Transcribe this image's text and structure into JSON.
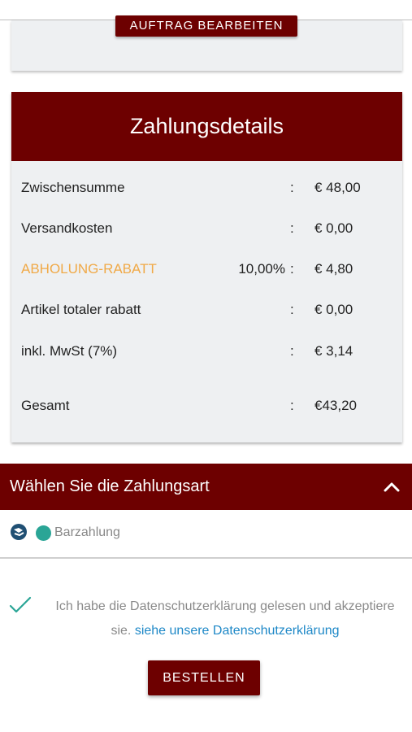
{
  "edit_order": {
    "button_label": "AUFTRAG BEARBEITEN"
  },
  "payment_details": {
    "title": "Zahlungsdetails",
    "rows": [
      {
        "label": "Zwischensumme",
        "percent": "",
        "colon": ":",
        "value": "€ 48,00"
      },
      {
        "label": "Versandkosten",
        "percent": "",
        "colon": ":",
        "value": "€ 0,00"
      },
      {
        "label": "ABHOLUNG-RABATT",
        "percent": "10,00%",
        "colon": ":",
        "value": "€ 4,80"
      },
      {
        "label": "Artikel totaler rabatt",
        "percent": "",
        "colon": ":",
        "value": "€ 0,00"
      },
      {
        "label": "inkl. MwSt (7%)",
        "percent": "",
        "colon": ":",
        "value": "€ 3,14"
      },
      {
        "label": "Gesamt",
        "percent": "",
        "colon": ":",
        "value": "€43,20"
      }
    ]
  },
  "payment_method": {
    "title": "Wählen Sie die Zahlungsart",
    "chevron_icon": "chevron-up-icon",
    "selected_option": "Barzahlung",
    "option_icon": "cash-payment-icon"
  },
  "consent": {
    "check_icon": "checkmark-icon",
    "text": "Ich habe die Datenschutzerklärung gelesen und akzeptiere sie.",
    "link": "siehe unsere Datenschutzerklärung"
  },
  "order_button": {
    "label": "BESTELLEN"
  },
  "colors": {
    "brand": "#6d0000",
    "card_bg": "#eef0f2",
    "discount": "#f0a947",
    "link": "#1e88c7",
    "radio": "#2aa596"
  }
}
